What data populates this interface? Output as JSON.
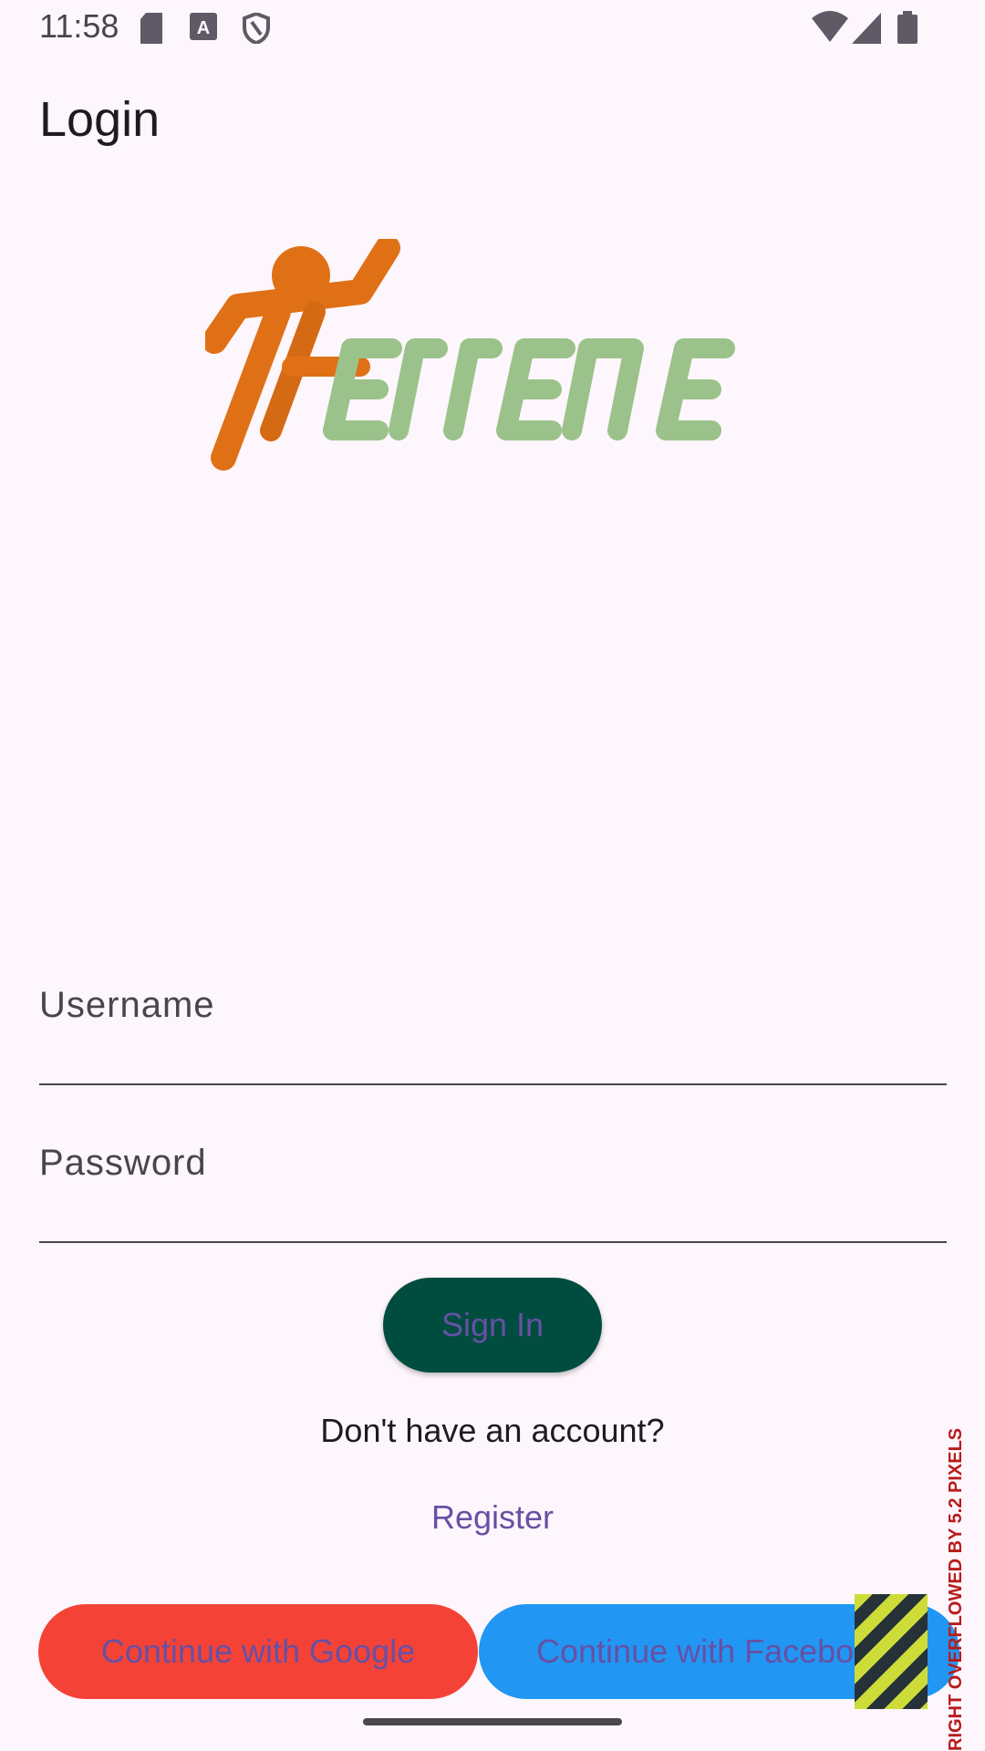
{
  "status_bar": {
    "time": "11:58",
    "left_icons": [
      "sd-card-icon",
      "text-a-icon",
      "shield-icon"
    ],
    "right_icons": [
      "wifi-icon",
      "signal-icon",
      "battery-icon"
    ]
  },
  "app_bar": {
    "title": "Login"
  },
  "logo": {
    "text": "TERRENE",
    "colors": {
      "figure": "#e07016",
      "letters": "#9bc28a"
    }
  },
  "form": {
    "username_label": "Username",
    "password_label": "Password",
    "sign_in": "Sign In",
    "no_account": "Don't have an account?",
    "register": "Register"
  },
  "oauth": {
    "google": "Continue with Google",
    "facebook": "Continue with Facebook"
  },
  "debug": {
    "overflow_text": "RIGHT OVERFLOWED BY 5.2 PIXELS"
  },
  "colors": {
    "background": "#fdf6fc",
    "sign_in_bg": "#004d40",
    "google_bg": "#f44336",
    "facebook_bg": "#2196f3",
    "link": "#6750a4"
  }
}
